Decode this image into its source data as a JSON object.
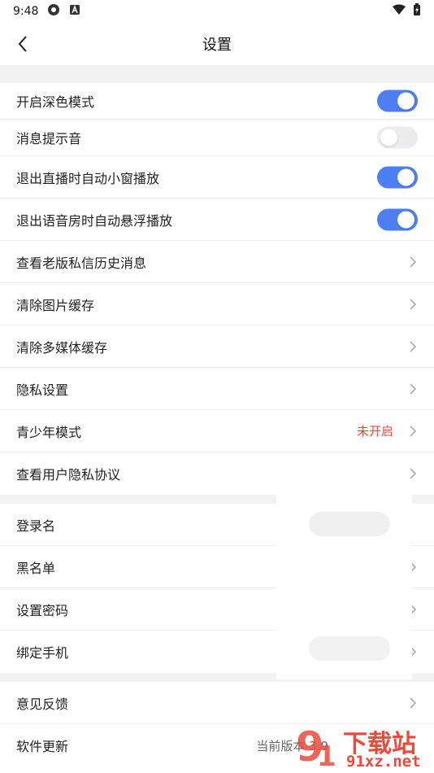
{
  "status_bar": {
    "time": "9:48"
  },
  "nav": {
    "title": "设置"
  },
  "group1": [
    {
      "label": "开启深色模式",
      "type": "toggle",
      "on": true
    },
    {
      "label": "消息提示音",
      "type": "toggle",
      "on": false
    },
    {
      "label": "退出直播时自动小窗播放",
      "type": "toggle",
      "on": true
    },
    {
      "label": "退出语音房时自动悬浮播放",
      "type": "toggle",
      "on": true
    },
    {
      "label": "查看老版私信历史消息",
      "type": "link"
    },
    {
      "label": "清除图片缓存",
      "type": "link"
    },
    {
      "label": "清除多媒体缓存",
      "type": "link"
    },
    {
      "label": "隐私设置",
      "type": "link"
    },
    {
      "label": "青少年模式",
      "type": "link",
      "value": "未开启"
    },
    {
      "label": "查看用户隐私协议",
      "type": "link"
    }
  ],
  "group2": [
    {
      "label": "登录名"
    },
    {
      "label": "黑名单"
    },
    {
      "label": "设置密码"
    },
    {
      "label": "绑定手机"
    }
  ],
  "group3": [
    {
      "label": "意见反馈"
    },
    {
      "label": "软件更新",
      "value": "当前版本 3.9"
    }
  ],
  "colors": {
    "accent": "#4d7ef2",
    "warning": "#e84a3b"
  },
  "watermark": {
    "top": "下载站",
    "bottom": "91xz.net"
  }
}
